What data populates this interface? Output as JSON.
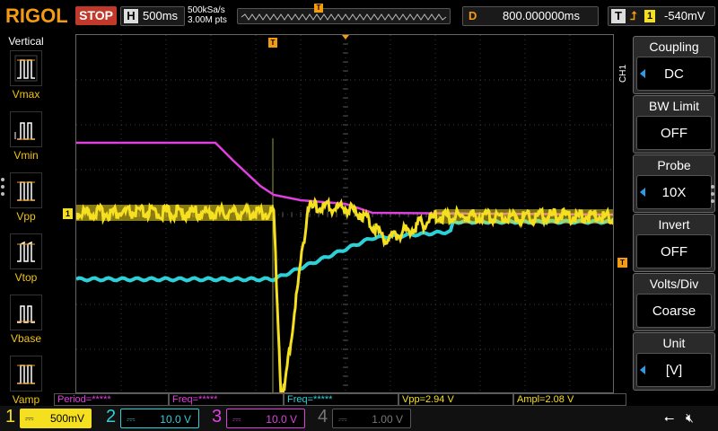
{
  "topbar": {
    "brand": "RIGOL",
    "run_state": "STOP",
    "timebase_key": "H",
    "timebase_value": "500ms",
    "sample_rate": "500kSa/s",
    "memory_depth": "3.00M pts",
    "delay_key": "D",
    "delay_value": "800.000000ms",
    "trigger_key": "T",
    "trigger_channel": "1",
    "trigger_level": "-540mV"
  },
  "left_panel": {
    "title": "Vertical",
    "items": [
      {
        "label": "Vmax",
        "icon": "vmax-icon"
      },
      {
        "label": "Vmin",
        "icon": "vmin-icon"
      },
      {
        "label": "Vpp",
        "icon": "vpp-icon"
      },
      {
        "label": "Vtop",
        "icon": "vtop-icon"
      },
      {
        "label": "Vbase",
        "icon": "vbase-icon"
      },
      {
        "label": "Vamp",
        "icon": "vamp-icon"
      }
    ]
  },
  "right_panel": {
    "channel_tag": "CH1",
    "items": [
      {
        "title": "Coupling",
        "value": "DC",
        "has_arrow": true
      },
      {
        "title": "BW Limit",
        "value": "OFF",
        "has_arrow": false
      },
      {
        "title": "Probe",
        "value": "10X",
        "has_arrow": true
      },
      {
        "title": "Invert",
        "value": "OFF",
        "has_arrow": false
      },
      {
        "title": "Volts/Div",
        "value": "Coarse",
        "has_arrow": false
      },
      {
        "title": "Unit",
        "value": "[V]",
        "has_arrow": true
      }
    ]
  },
  "markers": {
    "trigger_pos": "T",
    "ch1_ground": "1",
    "trigger_level": "T"
  },
  "measurements": [
    {
      "text": "Period=*****",
      "color": "#e040e0"
    },
    {
      "text": "Freq=*****",
      "color": "#e040e0"
    },
    {
      "text": "Freq=*****",
      "color": "#2ed0d8"
    },
    {
      "text": "Vpp=2.94 V",
      "color": "#f5e020"
    },
    {
      "text": "Ampl=2.08 V",
      "color": "#f5e020"
    }
  ],
  "channels": [
    {
      "num": "1",
      "coupling": "DC",
      "scale": "500mV",
      "color": "#f5e020",
      "active": true
    },
    {
      "num": "2",
      "coupling": "DC",
      "scale": "10.0 V",
      "color": "#2ed0d8",
      "active": false
    },
    {
      "num": "3",
      "coupling": "DC",
      "scale": "10.0 V",
      "color": "#e040e0",
      "active": false
    },
    {
      "num": "4",
      "coupling": "DC",
      "scale": "1.00 V",
      "color": "#777777",
      "active": false
    }
  ],
  "status_icons": {
    "usb": "usb-icon",
    "sound": "speaker-muted-icon"
  },
  "colors": {
    "ch1": "#f5e020",
    "ch2": "#2ed0d8",
    "ch3": "#e040e0",
    "ch4": "#777777",
    "accent_orange": "#f39c12",
    "stop_red": "#c0392b"
  }
}
